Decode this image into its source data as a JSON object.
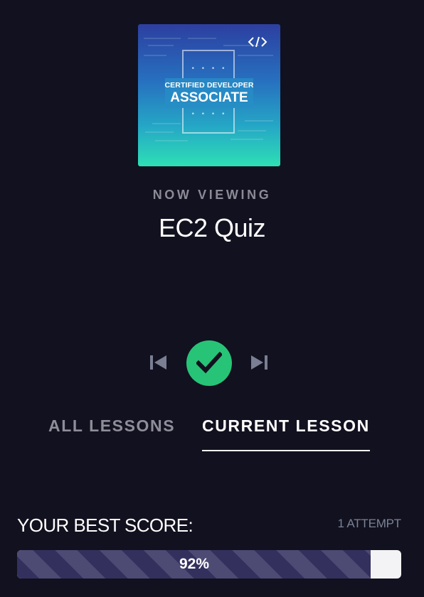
{
  "course": {
    "card_line1": "CERTIFIED DEVELOPER",
    "card_line2": "ASSOCIATE",
    "card_icon": "code-icon",
    "gradient_colors": [
      "#2c3fa0",
      "#2770bf",
      "#25a7c6",
      "#2ee0b4"
    ]
  },
  "now_viewing_label": "NOW VIEWING",
  "lesson_title": "EC2 Quiz",
  "controls": {
    "prev_icon": "skip-previous-icon",
    "complete_icon": "checkmark-icon",
    "complete_color": "#27c477",
    "next_icon": "skip-next-icon"
  },
  "tabs": [
    {
      "label": "ALL LESSONS",
      "active": false
    },
    {
      "label": "CURRENT LESSON",
      "active": true
    }
  ],
  "score": {
    "label": "YOUR BEST SCORE:",
    "attempts": "1 ATTEMPT",
    "percent_text": "92%",
    "percent_value": 92
  },
  "colors": {
    "background": "#12111f",
    "accent_green": "#27c477",
    "bar_fill": "#34305e"
  }
}
